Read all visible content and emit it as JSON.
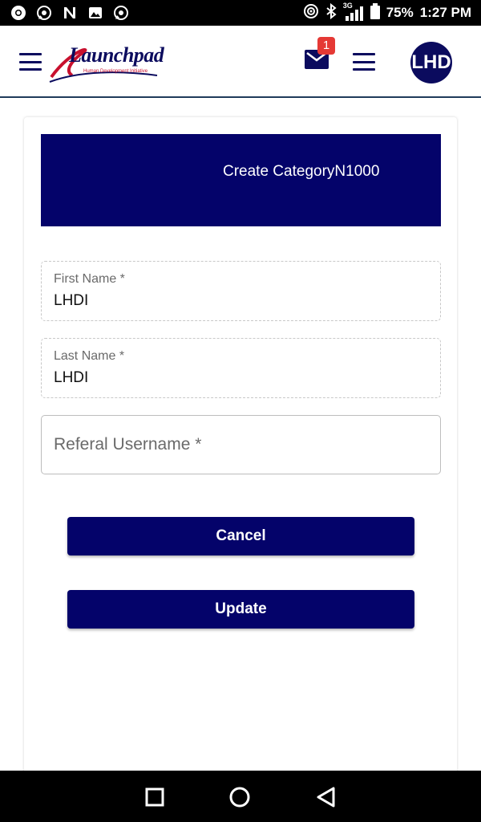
{
  "status_bar": {
    "notification_icons": [
      "chrome-icon",
      "whatsapp-icon",
      "n-icon",
      "gallery-icon",
      "whatsapp-icon"
    ],
    "network": "3G",
    "battery": "75%",
    "time": "1:27 PM"
  },
  "header": {
    "logo_text": "Launchpad",
    "logo_subtitle": "Human Development Initiative",
    "mail_badge": "1",
    "avatar_text": "LHD"
  },
  "banner": {
    "title": "Create CategoryN1000"
  },
  "form": {
    "first_name": {
      "label": "First Name *",
      "value": "LHDI"
    },
    "last_name": {
      "label": "Last Name *",
      "value": "LHDI"
    },
    "referal_username": {
      "placeholder": "Referal Username *"
    }
  },
  "buttons": {
    "cancel": "Cancel",
    "update": "Update"
  },
  "colors": {
    "primary": "#04036a",
    "badge": "#e53935",
    "header_border": "#1f3b5a"
  }
}
